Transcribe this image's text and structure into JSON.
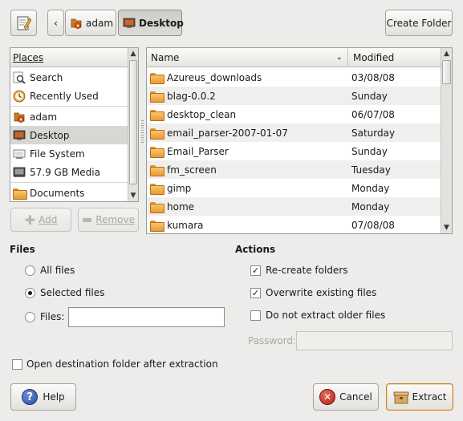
{
  "toolbar": {
    "path_buttons": [
      {
        "label": "adam"
      },
      {
        "label": "Desktop"
      }
    ],
    "create_folder_label": "Create Folder"
  },
  "places": {
    "header": "Places",
    "items": [
      {
        "label": "Search",
        "icon": "search-icon"
      },
      {
        "label": "Recently Used",
        "icon": "recent-icon"
      },
      {
        "label": "adam",
        "icon": "home-icon"
      },
      {
        "label": "Desktop",
        "icon": "desktop-icon",
        "selected": true
      },
      {
        "label": "File System",
        "icon": "filesystem-icon"
      },
      {
        "label": "57.9 GB Media",
        "icon": "drive-icon"
      },
      {
        "label": "Documents",
        "icon": "folder-icon"
      }
    ],
    "add_label": "Add",
    "remove_label": "Remove"
  },
  "files_list": {
    "col_name": "Name",
    "col_modified": "Modified",
    "rows": [
      {
        "name": "Azureus_downloads",
        "modified": "03/08/08"
      },
      {
        "name": "blag-0.0.2",
        "modified": "Sunday"
      },
      {
        "name": "desktop_clean",
        "modified": "06/07/08"
      },
      {
        "name": "email_parser-2007-01-07",
        "modified": "Saturday"
      },
      {
        "name": "Email_Parser",
        "modified": "Sunday"
      },
      {
        "name": "fm_screen",
        "modified": "Tuesday"
      },
      {
        "name": "gimp",
        "modified": "Monday"
      },
      {
        "name": "home",
        "modified": "Monday"
      },
      {
        "name": "kumara",
        "modified": "07/08/08"
      }
    ]
  },
  "files_section": {
    "title": "Files",
    "all_files": "All files",
    "selected_files": "Selected files",
    "files_label": "Files:",
    "files_value": "",
    "selected": "selected_files"
  },
  "actions_section": {
    "title": "Actions",
    "recreate_folders": "Re-create folders",
    "recreate_checked": true,
    "overwrite": "Overwrite existing files",
    "overwrite_checked": true,
    "no_older": "Do not extract older files",
    "no_older_checked": false,
    "password_label": "Password:",
    "password_value": ""
  },
  "open_dest": {
    "label": "Open destination folder after extraction",
    "checked": false
  },
  "buttons": {
    "help": "Help",
    "cancel": "Cancel",
    "extract": "Extract"
  }
}
